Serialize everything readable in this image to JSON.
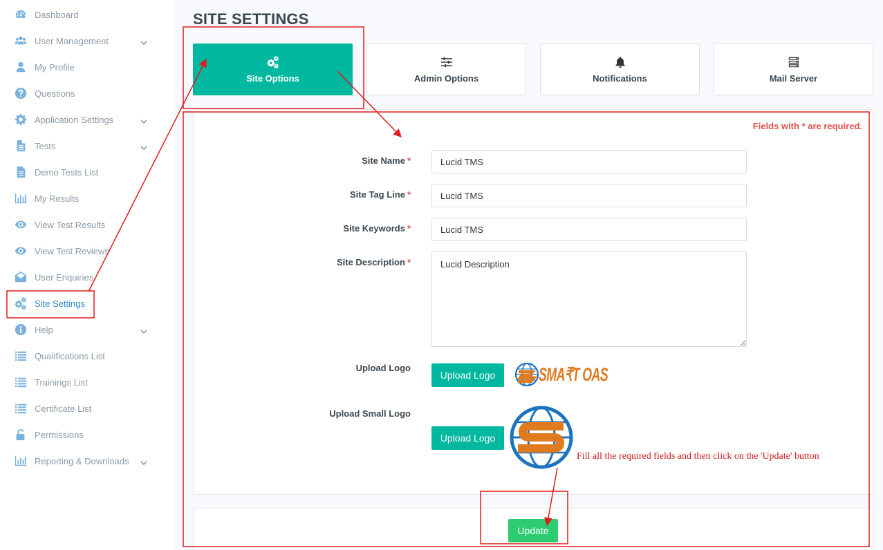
{
  "sidebar": {
    "items": [
      {
        "label": "Dashboard",
        "icon": "dashboard-icon",
        "chevron": false
      },
      {
        "label": "User Management",
        "icon": "users-icon",
        "chevron": true
      },
      {
        "label": "My Profile",
        "icon": "user-icon",
        "chevron": false
      },
      {
        "label": "Questions",
        "icon": "question-circle-icon",
        "chevron": false
      },
      {
        "label": "Application Settings",
        "icon": "gear-icon",
        "chevron": true
      },
      {
        "label": "Tests",
        "icon": "file-icon",
        "chevron": true
      },
      {
        "label": "Demo Tests List",
        "icon": "file-list-icon",
        "chevron": false
      },
      {
        "label": "My Results",
        "icon": "bar-chart-icon",
        "chevron": false
      },
      {
        "label": "View Test Results",
        "icon": "eye-icon",
        "chevron": false
      },
      {
        "label": "View Test Reviews",
        "icon": "eye-icon",
        "chevron": false
      },
      {
        "label": "User Enquiries",
        "icon": "envelope-open-icon",
        "chevron": false
      },
      {
        "label": "Site Settings",
        "icon": "gears-icon",
        "chevron": false,
        "active": true
      },
      {
        "label": "Help",
        "icon": "info-circle-icon",
        "chevron": true
      },
      {
        "label": "Qualifications List",
        "icon": "list-icon",
        "chevron": false
      },
      {
        "label": "Trainings List",
        "icon": "list-icon",
        "chevron": false
      },
      {
        "label": "Certificate List",
        "icon": "list-icon",
        "chevron": false
      },
      {
        "label": "Permissions",
        "icon": "unlock-icon",
        "chevron": false
      },
      {
        "label": "Reporting & Downloads",
        "icon": "bar-chart-icon",
        "chevron": true
      }
    ]
  },
  "page": {
    "title": "SITE SETTINGS"
  },
  "tabs": [
    {
      "label": "Site Options",
      "icon": "gears-icon",
      "active": true
    },
    {
      "label": "Admin Options",
      "icon": "sliders-icon",
      "active": false
    },
    {
      "label": "Notifications",
      "icon": "bell-icon",
      "active": false
    },
    {
      "label": "Mail Server",
      "icon": "server-icon",
      "active": false
    }
  ],
  "form": {
    "required_note": "Fields with * are required.",
    "required_mark": "*",
    "site_name": {
      "label": "Site Name",
      "value": "Lucid TMS"
    },
    "site_tagline": {
      "label": "Site Tag Line",
      "value": "Lucid TMS"
    },
    "site_keywords": {
      "label": "Site Keywords",
      "value": "Lucid TMS"
    },
    "site_description": {
      "label": "Site Description",
      "value": "Lucid Description"
    },
    "upload_logo": {
      "label": "Upload Logo",
      "button": "Upload Logo"
    },
    "upload_small_logo": {
      "label": "Upload Small Logo",
      "button": "Upload Logo"
    },
    "logo_text": "SMA₹T OAS",
    "update_button": "Update"
  },
  "annotation": {
    "text": "Fill all the required fields and then click on the 'Update' button",
    "color": "#e01b1b"
  },
  "colors": {
    "accent_teal": "#00b89f",
    "update_green": "#2ecc71",
    "required_red": "#e2504b",
    "sidebar_icon": "#7ab1dd",
    "logo_orange": "#e07a1f",
    "logo_blue": "#1e73be"
  }
}
